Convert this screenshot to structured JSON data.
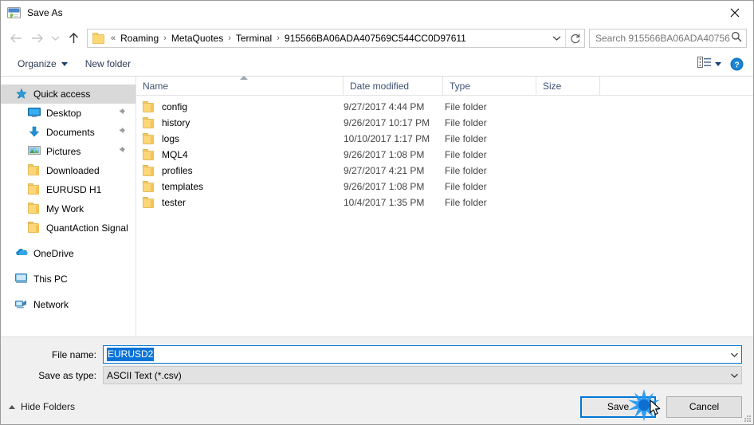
{
  "window": {
    "title": "Save As",
    "app_icon": "save-as-app-icon",
    "close_label": "✕"
  },
  "nav": {
    "back_icon": "back-arrow-icon",
    "forward_icon": "forward-arrow-icon",
    "recent_icon": "recent-locations-chevron-icon",
    "up_icon": "up-arrow-icon",
    "breadcrumb_prefix": "«",
    "breadcrumb": [
      "Roaming",
      "MetaQuotes",
      "Terminal",
      "915566BA06ADA407569C544CC0D97611"
    ],
    "breadcrumb_separator": "›",
    "dropdown_icon": "chevron-down-icon",
    "refresh_icon": "refresh-icon"
  },
  "search": {
    "placeholder": "Search 915566BA06ADA40756...",
    "icon": "search-icon"
  },
  "toolbar": {
    "organize_label": "Organize",
    "new_folder_label": "New folder",
    "view_icon": "view-layout-icon",
    "view_dropdown_icon": "chevron-down-icon",
    "help_icon": "help-circle-icon"
  },
  "sidebar": {
    "items": [
      {
        "label": "Quick access",
        "icon": "star-pin-icon",
        "indent": false,
        "selected": true,
        "pinned": false
      },
      {
        "label": "Desktop",
        "icon": "desktop-monitor-icon",
        "indent": true,
        "selected": false,
        "pinned": true
      },
      {
        "label": "Documents",
        "icon": "documents-download-icon",
        "indent": true,
        "selected": false,
        "pinned": true
      },
      {
        "label": "Pictures",
        "icon": "pictures-icon",
        "indent": true,
        "selected": false,
        "pinned": true
      },
      {
        "label": "Downloaded",
        "icon": "folder-icon",
        "indent": true,
        "selected": false,
        "pinned": false
      },
      {
        "label": "EURUSD H1",
        "icon": "folder-icon",
        "indent": true,
        "selected": false,
        "pinned": false
      },
      {
        "label": "My Work",
        "icon": "folder-icon",
        "indent": true,
        "selected": false,
        "pinned": false
      },
      {
        "label": "QuantAction Signal",
        "icon": "folder-icon",
        "indent": true,
        "selected": false,
        "pinned": false
      }
    ],
    "groups": [
      {
        "label": "OneDrive",
        "icon": "onedrive-cloud-icon"
      },
      {
        "label": "This PC",
        "icon": "this-pc-icon"
      },
      {
        "label": "Network",
        "icon": "network-icon"
      }
    ]
  },
  "filelist": {
    "columns": [
      "Name",
      "Date modified",
      "Type",
      "Size"
    ],
    "sort_column": "Name",
    "sort_direction": "ascending",
    "rows": [
      {
        "name": "config",
        "date": "9/27/2017 4:44 PM",
        "type": "File folder",
        "size": ""
      },
      {
        "name": "history",
        "date": "9/26/2017 10:17 PM",
        "type": "File folder",
        "size": ""
      },
      {
        "name": "logs",
        "date": "10/10/2017 1:17 PM",
        "type": "File folder",
        "size": ""
      },
      {
        "name": "MQL4",
        "date": "9/26/2017 1:08 PM",
        "type": "File folder",
        "size": ""
      },
      {
        "name": "profiles",
        "date": "9/27/2017 4:21 PM",
        "type": "File folder",
        "size": ""
      },
      {
        "name": "templates",
        "date": "9/26/2017 1:08 PM",
        "type": "File folder",
        "size": ""
      },
      {
        "name": "tester",
        "date": "10/4/2017 1:35 PM",
        "type": "File folder",
        "size": ""
      }
    ]
  },
  "form": {
    "filename_label": "File name:",
    "filename_value": "EURUSD2",
    "filetype_label": "Save as type:",
    "filetype_value": "ASCII Text (*.csv)",
    "dropdown_icon": "chevron-down-icon"
  },
  "footer": {
    "hide_folders_label": "Hide Folders",
    "hide_folders_icon": "caret-up-icon",
    "save_label": "Save",
    "cancel_label": "Cancel",
    "resize_grip_icon": "resize-grip-icon"
  },
  "colors": {
    "accent": "#0078d7",
    "folder": "#fcd77a",
    "selection": "#0a73d7",
    "toolbar_text": "#2b3a55",
    "header_text": "#3b5173"
  }
}
